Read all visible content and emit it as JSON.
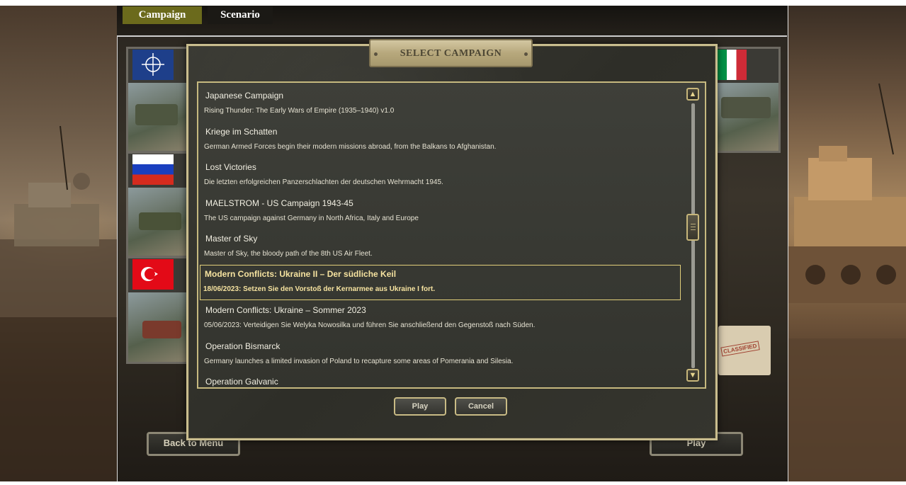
{
  "tabs": [
    {
      "label": "Campaign",
      "active": true
    },
    {
      "label": "Scenario",
      "active": false
    }
  ],
  "dialog": {
    "title": "SELECT CAMPAIGN",
    "play_label": "Play",
    "cancel_label": "Cancel"
  },
  "campaigns": [
    {
      "name": "Japanese Campaign",
      "description": "Rising Thunder: The Early Wars of Empire (1935–1940) v1.0",
      "selected": false
    },
    {
      "name": "Kriege im Schatten",
      "description": "German Armed Forces begin their modern missions abroad, from the Balkans to Afghanistan.",
      "selected": false
    },
    {
      "name": "Lost Victories",
      "description": "Die letzten erfolgreichen Panzerschlachten der deutschen Wehrmacht 1945.",
      "selected": false
    },
    {
      "name": "MAELSTROM - US Campaign 1943-45",
      "description": "The US campaign against Germany in North Africa, Italy and Europe",
      "selected": false
    },
    {
      "name": "Master of Sky",
      "description": "Master of Sky, the bloody path of the 8th US Air Fleet.",
      "selected": false
    },
    {
      "name": "Modern Conflicts: Ukraine II – Der südliche Keil",
      "description": "18/06/2023: Setzen Sie den Vorstoß der Kernarmee aus Ukraine I fort.",
      "selected": true
    },
    {
      "name": "Modern Conflicts: Ukraine – Sommer 2023",
      "description": "05/06/2023: Verteidigen Sie Welyka Nowosilka und führen Sie anschließend den Gegenstoß nach Süden.",
      "selected": false
    },
    {
      "name": "Operation Bismarck",
      "description": "Germany launches a limited invasion of Poland to recapture some areas of Pomerania and Silesia.",
      "selected": false
    },
    {
      "name": "Operation Galvanic",
      "description": "",
      "selected": false
    }
  ],
  "background_buttons": {
    "back_label": "Back to Menu",
    "play_label": "Play"
  },
  "folder_stamp": "CLASSIFIED",
  "icons": {
    "scroll_up": "arrow-up-icon",
    "scroll_down": "arrow-down-icon"
  },
  "colors": {
    "tab_active": "#6b6a1c",
    "selected_text": "#f6e3a0",
    "frame_gold": "#c9bd8e"
  }
}
